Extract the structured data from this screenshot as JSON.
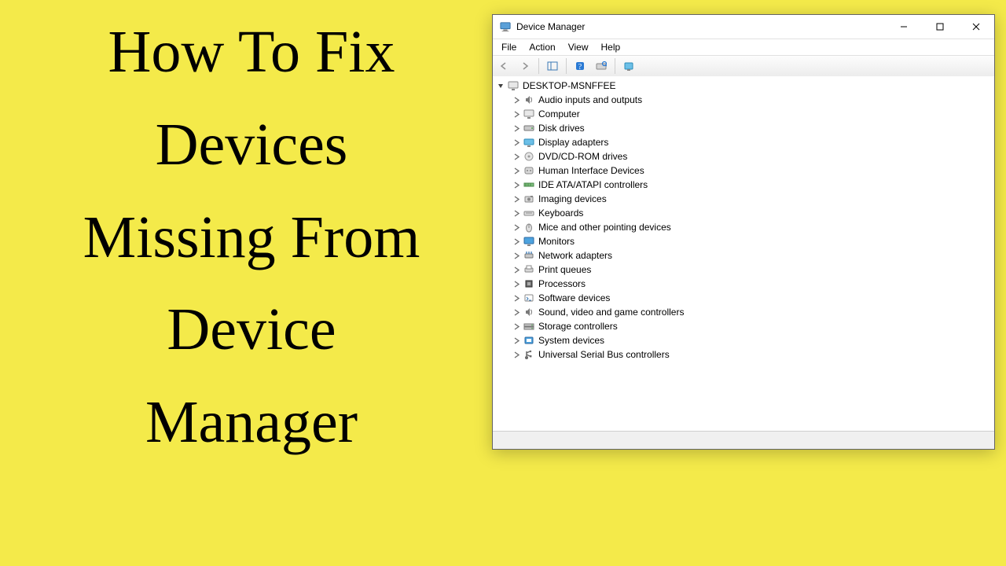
{
  "headline": {
    "line1": "How To Fix",
    "line2": "Devices",
    "line3": "Missing From",
    "line4": "Device",
    "line5": "Manager"
  },
  "window": {
    "title": "Device Manager",
    "menu": {
      "file": "File",
      "action": "Action",
      "view": "View",
      "help": "Help"
    },
    "root": "DESKTOP-MSNFFEE",
    "categories": [
      "Audio inputs and outputs",
      "Computer",
      "Disk drives",
      "Display adapters",
      "DVD/CD-ROM drives",
      "Human Interface Devices",
      "IDE ATA/ATAPI controllers",
      "Imaging devices",
      "Keyboards",
      "Mice and other pointing devices",
      "Monitors",
      "Network adapters",
      "Print queues",
      "Processors",
      "Software devices",
      "Sound, video and game controllers",
      "Storage controllers",
      "System devices",
      "Universal Serial Bus controllers"
    ]
  },
  "colors": {
    "bg": "#f4ea4a"
  }
}
